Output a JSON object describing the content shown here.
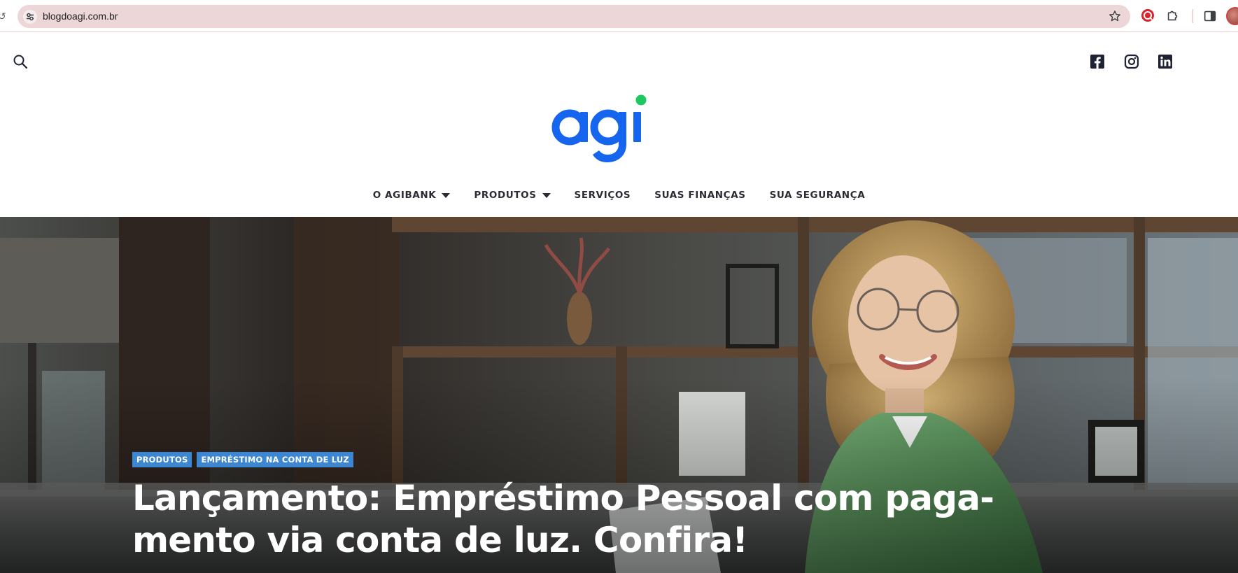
{
  "browser": {
    "url": "blogdoagi.com.br",
    "icons": [
      "site-settings-icon",
      "bookmark-star-icon",
      "extension-red-icon",
      "extensions-puzzle-icon",
      "side-panel-icon",
      "profile-avatar"
    ]
  },
  "site": {
    "logo_text": "agi",
    "brand_colors": {
      "blue": "#1565ee",
      "green": "#1ec760"
    },
    "social_icons": [
      "facebook-icon",
      "instagram-icon",
      "linkedin-icon"
    ],
    "nav": [
      {
        "label": "O AGIBANK",
        "dropdown": true
      },
      {
        "label": "PRODUTOS",
        "dropdown": true
      },
      {
        "label": "SERVIÇOS",
        "dropdown": false
      },
      {
        "label": "SUAS FINANÇAS",
        "dropdown": false
      },
      {
        "label": "SUA SEGURANÇA",
        "dropdown": false
      }
    ]
  },
  "hero": {
    "tags": [
      "PRODUTOS",
      "EMPRÉSTIMO NA CONTA DE LUZ"
    ],
    "tag_color": "#3d86d1",
    "headline_line1": "Lançamento: Empréstimo Pessoal com paga-",
    "headline_line2": "mento via conta de luz. Confira!"
  }
}
